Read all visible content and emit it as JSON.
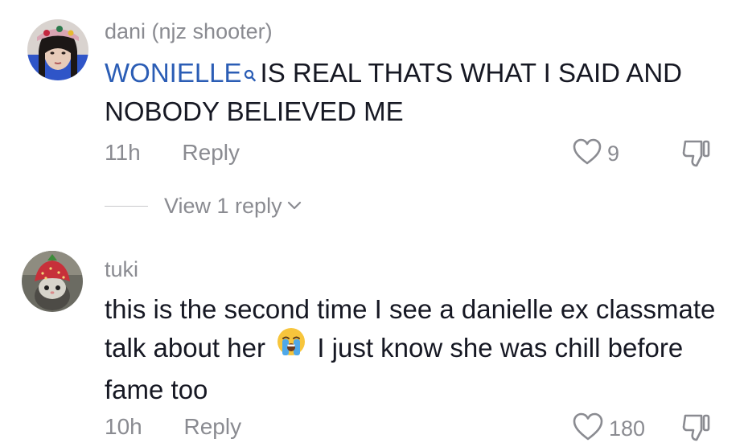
{
  "comments": [
    {
      "username": "dani (njz shooter)",
      "mention": "WONIELLE",
      "text_after_mention": "IS REAL THATS WHAT I SAID AND NOBODY BELIEVED ME",
      "time": "11h",
      "reply_label": "Reply",
      "like_count": "9",
      "view_replies_label": "View 1 reply"
    },
    {
      "username": "tuki",
      "text_before_emoji": "this is the second time I see a danielle ex classmate talk about her",
      "text_after_emoji": "I just know she was chill before fame too",
      "time": "10h",
      "reply_label": "Reply",
      "like_count": "180"
    }
  ],
  "icons": {
    "mention": "search-icon",
    "like": "heart-icon",
    "dislike": "thumbs-down-icon",
    "expand": "chevron-down-icon",
    "emoji": "loudly-crying-face-emoji"
  },
  "colors": {
    "username": "#8a8b91",
    "body_text": "#161823",
    "mention": "#2b5db5",
    "meta": "#8a8b91"
  }
}
